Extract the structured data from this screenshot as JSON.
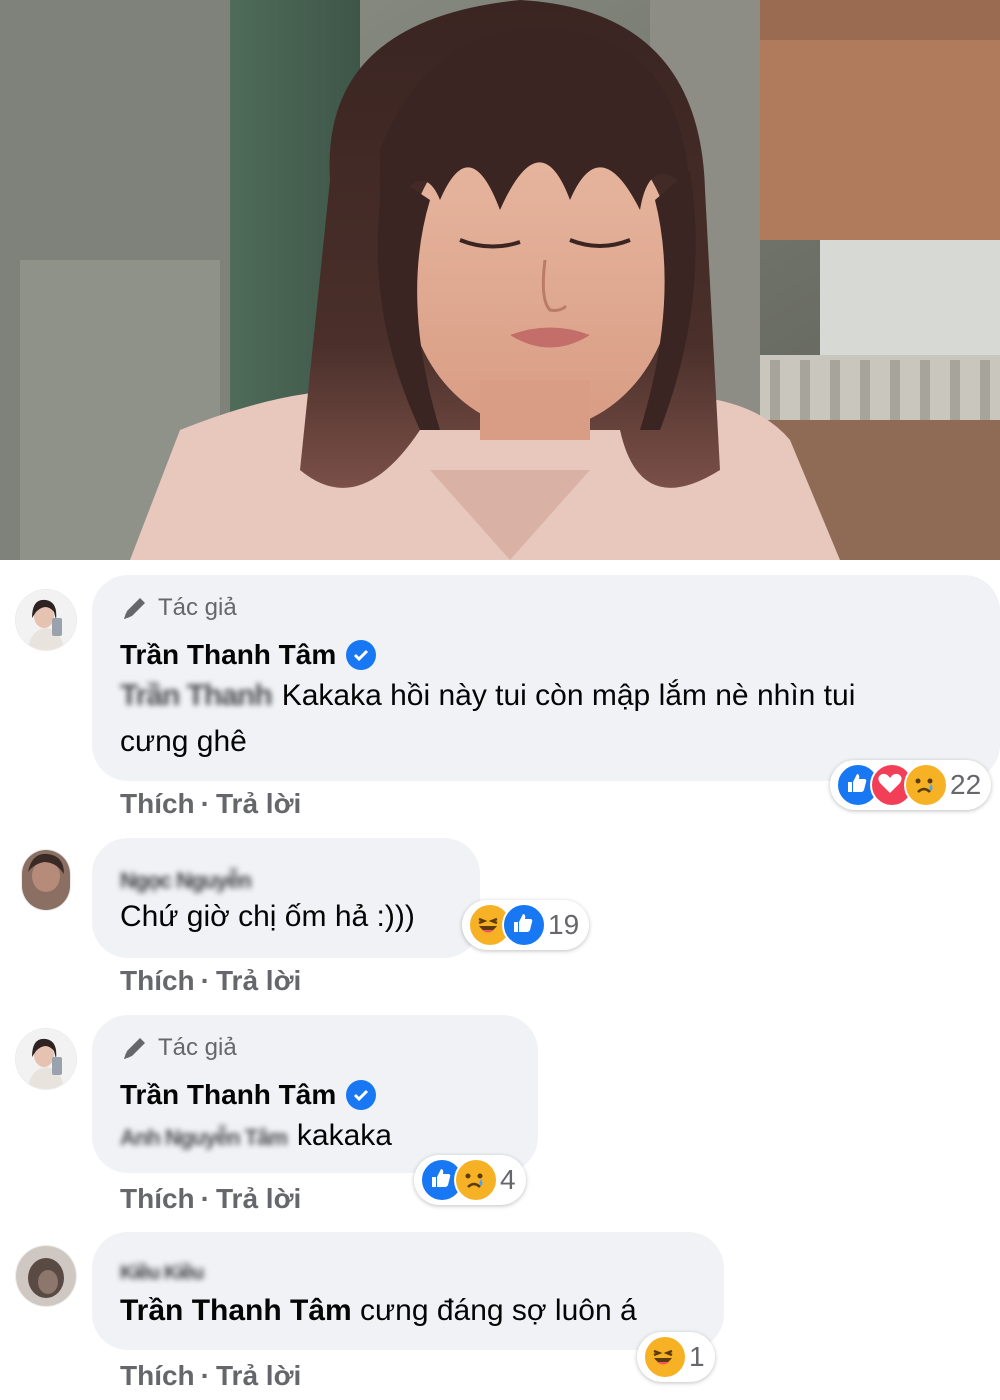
{
  "comments": [
    {
      "author_badge": "Tác giả",
      "name": "Trần Thanh Tâm",
      "blurred_mention": "Trần Thanh",
      "text_line1": "Kakaka hồi này tui còn mập lắm nè nhìn tui",
      "text_line2": "cưng ghê",
      "reaction_icons": [
        "like-icon",
        "love-icon",
        "sad-icon"
      ],
      "reaction_count": "22",
      "like": "Thích",
      "sep": "·",
      "reply": "Trả lời"
    },
    {
      "blurred_name": "Ngọc Nguyễn",
      "text": "Chứ giờ chị ốm hả :)))",
      "reaction_icons": [
        "haha-icon",
        "like-icon"
      ],
      "reaction_count": "19",
      "like": "Thích",
      "sep": "·",
      "reply": "Trả lời"
    },
    {
      "author_badge": "Tác giả",
      "name": "Trần Thanh Tâm",
      "blurred_mention": "Anh Nguyễn Tâm",
      "text": "kakaka",
      "reaction_icons": [
        "like-icon",
        "sad-icon"
      ],
      "reaction_count": "4",
      "like": "Thích",
      "sep": "·",
      "reply": "Trả lời"
    },
    {
      "blurred_name": "Kiều Kiều",
      "mention": "Trần Thanh Tâm",
      "text": "cưng đáng sợ luôn á",
      "reaction_icons": [
        "haha-icon"
      ],
      "reaction_count": "1",
      "like": "Thích",
      "sep": "·",
      "reply": "Trả lời"
    }
  ],
  "colors": {
    "bubble": "#f0f2f5",
    "meta_text": "#65676b",
    "like_blue": "#1877f2",
    "love_red": "#f33e58",
    "emoji_yellow": "#f7b125"
  }
}
